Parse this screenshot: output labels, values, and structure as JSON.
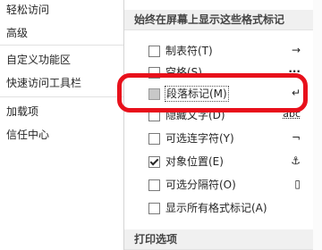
{
  "sidebar": {
    "items": [
      {
        "label": "轻松访问"
      },
      {
        "label": "高级"
      },
      {
        "label": "自定义功能区"
      },
      {
        "label": "快速访问工具栏"
      },
      {
        "label": "加载项"
      },
      {
        "label": "信任中心"
      }
    ]
  },
  "main": {
    "section_title": "始终在屏幕上显示这些格式标记",
    "options": [
      {
        "label": "制表符(T)",
        "symbol": "→",
        "checked": false
      },
      {
        "label": "空格(S)",
        "symbol": "···",
        "checked": false
      },
      {
        "label": "段落标记(M)",
        "symbol": "↵",
        "checked": false,
        "focused": true
      },
      {
        "label": "隐藏文字(D)",
        "symbol": "abc",
        "checked": false
      },
      {
        "label": "可选连字符(Y)",
        "symbol": "¬",
        "checked": false
      },
      {
        "label": "对象位置(E)",
        "symbol": "⚓",
        "checked": true
      },
      {
        "label": "可选分隔符(O)",
        "symbol": "▯",
        "checked": false
      },
      {
        "label": "显示所有格式标记(A)",
        "symbol": "",
        "checked": false
      }
    ],
    "print_section_title": "打印选项"
  },
  "colors": {
    "highlight": "#e8101b",
    "header_bg": "#f0f0f0"
  }
}
